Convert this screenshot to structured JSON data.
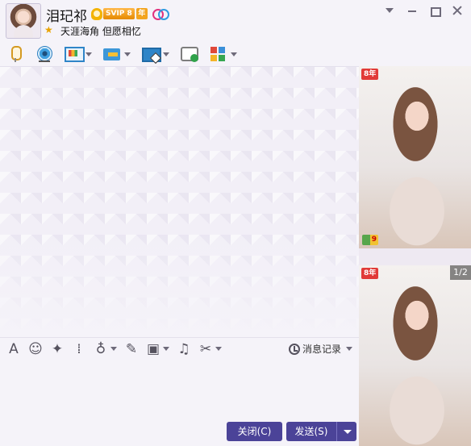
{
  "header": {
    "nickname": "泪玘祁",
    "vip_badge": "SVIP 8",
    "year_badge": "年",
    "signature": "天涯海角 但愿相忆"
  },
  "window_controls": [
    "dropdown",
    "minimize",
    "maximize",
    "close"
  ],
  "toolbar": {
    "items": [
      {
        "icon": "microphone-icon",
        "has_dropdown": false
      },
      {
        "icon": "video-call-icon",
        "has_dropdown": false
      },
      {
        "icon": "screen-share-icon",
        "has_dropdown": true
      },
      {
        "icon": "file-transfer-icon",
        "has_dropdown": true
      },
      {
        "icon": "remote-desktop-icon",
        "has_dropdown": true
      },
      {
        "icon": "new-message-icon",
        "has_dropdown": false
      },
      {
        "icon": "apps-icon",
        "has_dropdown": true
      }
    ]
  },
  "input_toolbar": {
    "items": [
      {
        "icon": "font-icon",
        "glyph": "A"
      },
      {
        "icon": "emoji-icon",
        "glyph": "☺"
      },
      {
        "icon": "magic-wand-icon",
        "glyph": "✦"
      },
      {
        "icon": "shake-icon",
        "glyph": "⁞"
      },
      {
        "icon": "voice-message-icon",
        "glyph": "♁"
      },
      {
        "icon": "edit-icon",
        "glyph": "✎"
      },
      {
        "icon": "image-icon",
        "glyph": "▣"
      },
      {
        "icon": "music-icon",
        "glyph": "♫"
      },
      {
        "icon": "screenshot-icon",
        "glyph": "✂"
      }
    ],
    "history_label": "消息记录"
  },
  "buttons": {
    "close_label": "关闭(C)",
    "send_label": "发送(S)"
  },
  "side_panel": {
    "top_vip_tag": "8年",
    "level_tag": "9",
    "bottom_vip_tag": "8年",
    "page_indicator": "1/2"
  },
  "colors": {
    "button_bg": "#4b4398",
    "window_bg": "#f5f3f9",
    "vip_gold": "#f3a41e",
    "vip_red": "#e13a38"
  }
}
